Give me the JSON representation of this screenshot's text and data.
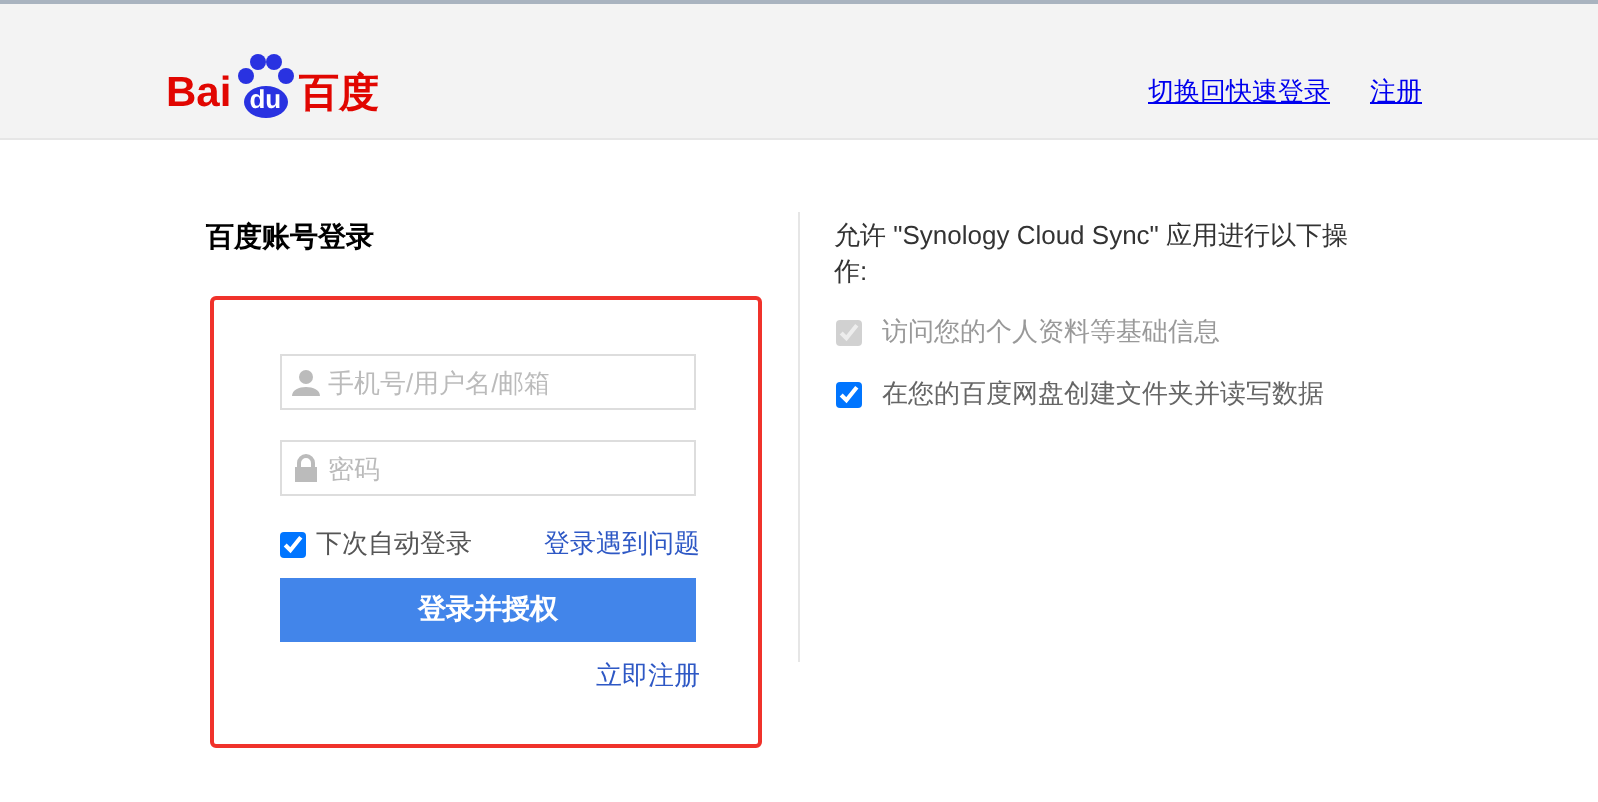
{
  "header": {
    "logo": {
      "latin": "Bai",
      "paw": "du",
      "chinese": "百度"
    },
    "links": [
      "切换回快速登录",
      "注册"
    ]
  },
  "login": {
    "title": "百度账号登录",
    "highlighted": true,
    "fields": [
      {
        "kind": "user",
        "placeholder": "手机号/用户名/邮箱"
      },
      {
        "kind": "password",
        "placeholder": "密码"
      }
    ],
    "remember": {
      "label": "下次自动登录",
      "checked": true
    },
    "help_link": "登录遇到问题",
    "submit": "登录并授权",
    "register_link": "立即注册"
  },
  "permissions": {
    "intro": "允许 \"Synology Cloud Sync\" 应用进行以下操作:",
    "items": [
      {
        "label": "访问您的个人资料等基础信息",
        "checked": true,
        "disabled": true
      },
      {
        "label": "在您的百度网盘创建文件夹并读写数据",
        "checked": true,
        "disabled": false
      }
    ]
  }
}
